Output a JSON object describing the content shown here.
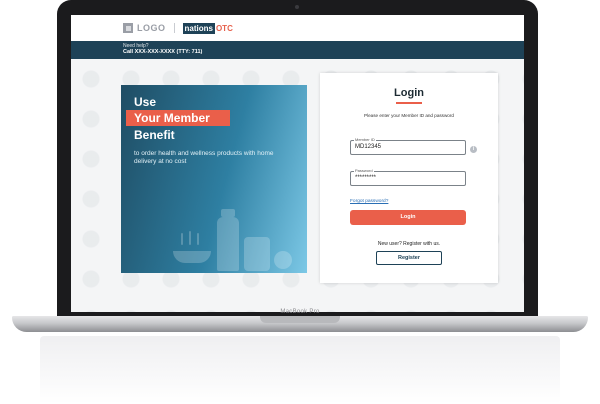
{
  "header": {
    "logo_text": "LOGO",
    "brand_nations": "nations",
    "brand_otc": "OTC"
  },
  "help_bar": {
    "line1": "Need help?",
    "line2": "Call XXX-XXX-XXXX (TTY: 711)"
  },
  "hero": {
    "line1": "Use",
    "line2": "Your Member",
    "line3": "Benefit",
    "subtitle": "to order health and wellness products with home delivery at no cost"
  },
  "login": {
    "title": "Login",
    "subtitle": "Please enter your Member ID and password",
    "member_id_label": "Member ID",
    "member_id_value": "MD12345",
    "password_label": "Password",
    "password_value": "*********",
    "forgot_link": "Forgot password?",
    "login_button": "Login",
    "new_user_text": "New user? Register with us.",
    "register_button": "Register"
  },
  "device": {
    "label": "MacBook Pro"
  },
  "colors": {
    "navy": "#1e4257",
    "coral": "#ea5f4a",
    "link": "#2a6fb5"
  }
}
